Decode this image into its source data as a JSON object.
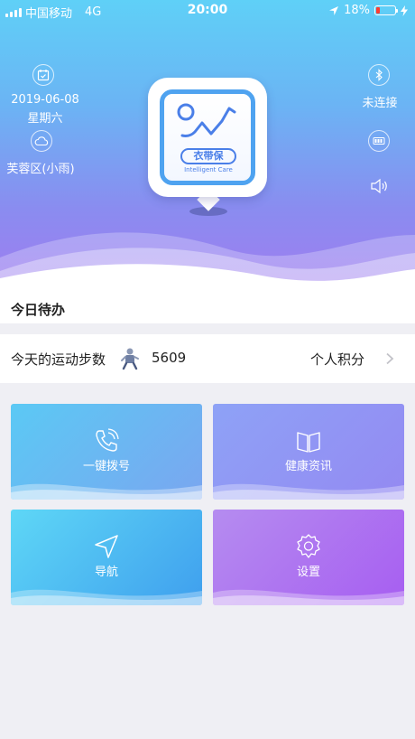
{
  "status_bar": {
    "carrier": "中国移动",
    "network": "4G",
    "time": "20:00",
    "battery": "18%",
    "battery_level": 0.18,
    "battery_color": "#ff3b30"
  },
  "hero": {
    "date": "2019-06-08",
    "weekday": "星期六",
    "location_weather": "芙蓉区(小雨)",
    "connection_status": "未连接",
    "logo_badge": "衣带保",
    "logo_subtitle": "Intelligent Care",
    "icons": [
      "calendar-icon",
      "cloud-icon",
      "bluetooth-icon",
      "battery-device-icon",
      "speaker-icon"
    ]
  },
  "todo": {
    "title": "今日待办"
  },
  "steps": {
    "label": "今天的运动步数",
    "value": "5609",
    "points_label": "个人积分"
  },
  "tiles": [
    {
      "label": "一键拨号",
      "icon": "phone-icon",
      "colors": [
        "#5bc9f4",
        "#7aa6f0"
      ]
    },
    {
      "label": "健康资讯",
      "icon": "book-icon",
      "colors": [
        "#8ea2f6",
        "#9489f2"
      ]
    },
    {
      "label": "导航",
      "icon": "navigation-icon",
      "colors": [
        "#5ed7f6",
        "#3f9fee"
      ]
    },
    {
      "label": "设置",
      "icon": "gear-icon",
      "colors": [
        "#b58cf0",
        "#a75ef1"
      ]
    }
  ],
  "colors": {
    "hero_top": "#5fd0f7",
    "hero_bottom": "#a27bef",
    "logo_blue": "#4a7fe8",
    "page_bg": "#efeff4"
  }
}
